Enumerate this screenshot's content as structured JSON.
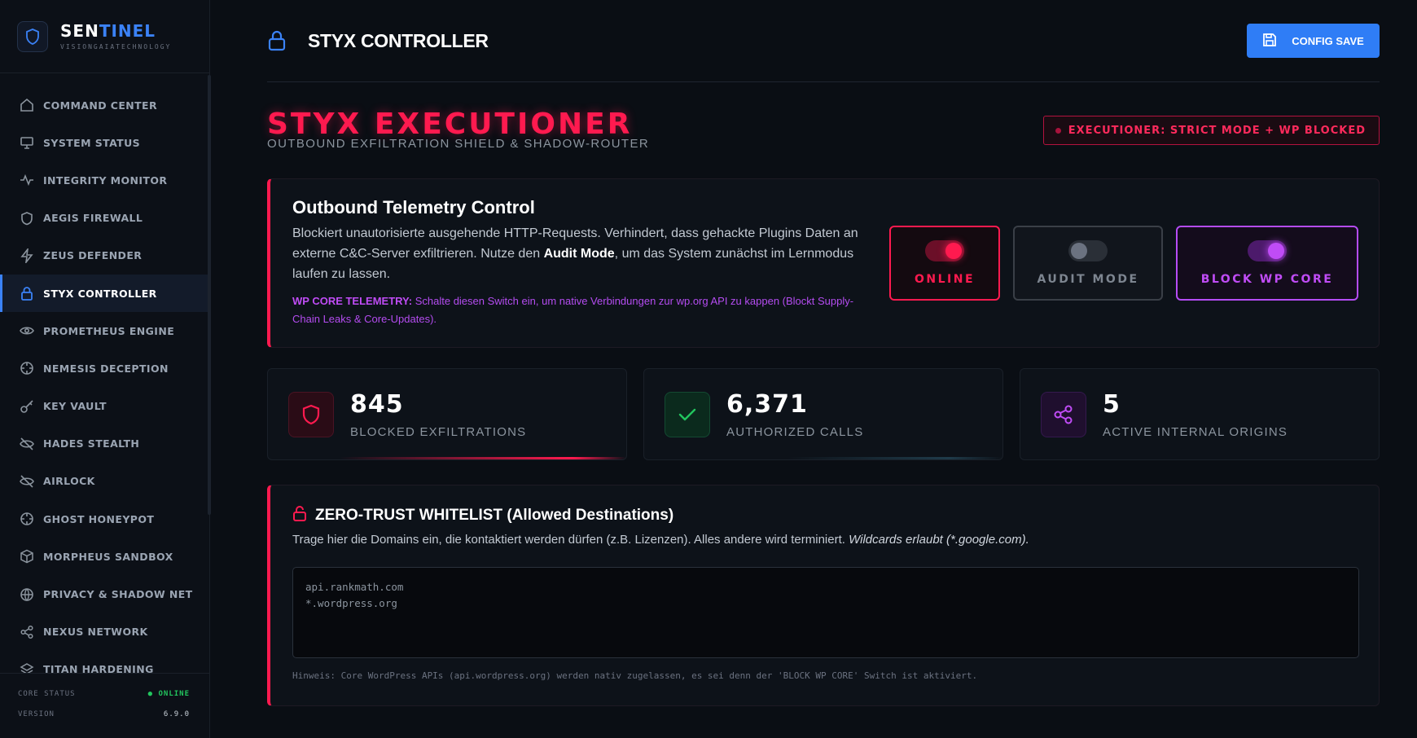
{
  "brand": {
    "name_a": "SEN",
    "name_b": "TINEL",
    "subtitle": "VISIONGAIATECHNOLOGY",
    "accent": "#3b82f6"
  },
  "sidebar": {
    "items": [
      {
        "label": "COMMAND CENTER",
        "icon": "home-icon"
      },
      {
        "label": "SYSTEM STATUS",
        "icon": "monitor-icon"
      },
      {
        "label": "INTEGRITY MONITOR",
        "icon": "activity-icon"
      },
      {
        "label": "AEGIS FIREWALL",
        "icon": "shield-icon"
      },
      {
        "label": "ZEUS DEFENDER",
        "icon": "bolt-icon"
      },
      {
        "label": "STYX CONTROLLER",
        "icon": "lock-icon",
        "active": true
      },
      {
        "label": "PROMETHEUS ENGINE",
        "icon": "eye-icon"
      },
      {
        "label": "NEMESIS DECEPTION",
        "icon": "crosshair-icon"
      },
      {
        "label": "KEY VAULT",
        "icon": "key-icon"
      },
      {
        "label": "HADES STEALTH",
        "icon": "eye-off-icon"
      },
      {
        "label": "AIRLOCK",
        "icon": "eye-off-icon"
      },
      {
        "label": "GHOST HONEYPOT",
        "icon": "crosshair-icon"
      },
      {
        "label": "MORPHEUS SANDBOX",
        "icon": "cube-icon"
      },
      {
        "label": "PRIVACY & SHADOW NET",
        "icon": "globe-icon"
      },
      {
        "label": "NEXUS NETWORK",
        "icon": "share-icon"
      },
      {
        "label": "TITAN HARDENING",
        "icon": "layers-icon"
      }
    ]
  },
  "core": {
    "status_label": "CORE STATUS",
    "status_value": "ONLINE",
    "version_label": "VERSION",
    "version_value": "6.9.0"
  },
  "header": {
    "title": "STYX CONTROLLER",
    "save_label": "CONFIG SAVE"
  },
  "hero": {
    "title": "STYX EXECUTIONER",
    "subtitle": "OUTBOUND EXFILTRATION SHIELD & SHADOW-ROUTER",
    "badge": "EXECUTIONER: STRICT MODE + WP BLOCKED"
  },
  "telemetry": {
    "title": "Outbound Telemetry Control",
    "desc_1": "Blockiert unautorisierte ausgehende HTTP-Requests. Verhindert, dass gehackte Plugins Daten an externe C&C-Server exfiltrieren. Nutze den ",
    "desc_bold": "Audit Mode",
    "desc_2": ", um das System zunächst im Lernmodus laufen zu lassen.",
    "note_bold": "WP CORE TELEMETRY:",
    "note": " Schalte diesen Switch ein, um native Verbindungen zur wp.org API zu kappen (Blockt Supply-Chain Leaks & Core-Updates).",
    "toggles": [
      {
        "label": "ONLINE",
        "on": true
      },
      {
        "label": "AUDIT MODE",
        "on": false
      },
      {
        "label": "BLOCK WP CORE",
        "on": true
      }
    ]
  },
  "stats": [
    {
      "value": "845",
      "label": "BLOCKED EXFILTRATIONS",
      "color": "#ff1a4f"
    },
    {
      "value": "6,371",
      "label": "AUTHORIZED CALLS",
      "color": "#22c55e"
    },
    {
      "value": "5",
      "label": "ACTIVE INTERNAL ORIGINS",
      "color": "#c04cf6"
    }
  ],
  "whitelist": {
    "title": "ZERO-TRUST WHITELIST (Allowed Destinations)",
    "desc": "Trage hier die Domains ein, die kontaktiert werden dürfen (z.B. Lizenzen). Alles andere wird terminiert. ",
    "desc_italic": "Wildcards erlaubt (*.google.com).",
    "value": "api.rankmath.com\n*.wordpress.org",
    "hint": "Hinweis: Core WordPress APIs (api.wordpress.org) werden nativ zugelassen, es sei denn der 'BLOCK WP CORE' Switch ist aktiviert."
  }
}
